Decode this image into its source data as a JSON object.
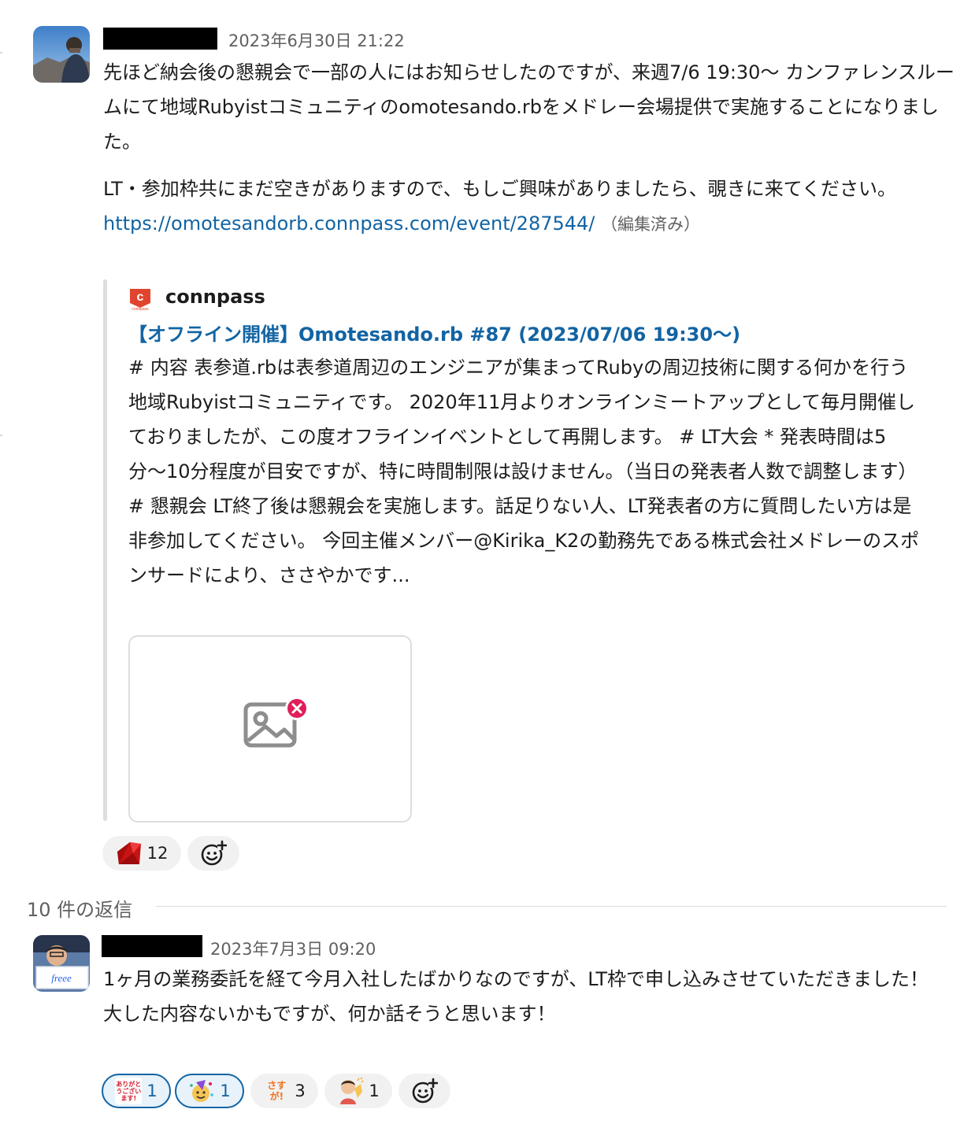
{
  "message": {
    "timestamp": "2023年6月30日 21:22",
    "paragraph1": "先ほど納会後の懇親会で一部の人にはお知らせしたのですが、来週7/6 19:30〜 カンファレンスルームにて地域Rubyistコミュニティのomotesando.rbをメドレー会場提供で実施することになりました。",
    "paragraph2": "LT・参加枠共にまだ空きがありますので、もしご興味がありましたら、覗きに来てください。",
    "link": "https://omotesandorb.connpass.com/event/287544/",
    "edited_label": "（編集済み）",
    "unfurl": {
      "site_name": "connpass",
      "logo_letter": "c",
      "logo_sub": "connpass",
      "title": "【オフライン開催】Omotesando.rb #87 (2023/07/06 19:30〜)",
      "description": "# 内容 表参道.rbは表参道周辺のエンジニアが集まってRubyの周辺技術に関する何かを行う地域Rubyistコミュニティです。 2020年11月よりオンラインミートアップとして毎月開催しておりましたが、この度オフラインイベントとして再開します。 # LT大会 * 発表時間は5分〜10分程度が目安ですが、特に時間制限は設けません。（当日の発表者人数で調整します） # 懇親会 LT終了後は懇親会を実施します。話足りない人、LT発表者の方に質問したい方は是非参加してください。 今回主催メンバー@Kirika_K2の勤務先である株式会社メドレーのスポンサードにより、ささやかです..."
    },
    "reactions": [
      {
        "icon": "ruby-gem-icon",
        "count": "12",
        "active": false
      }
    ]
  },
  "replies_label": "10 件の返信",
  "reply": {
    "timestamp": "2023年7月3日 09:20",
    "line1": "1ヶ月の業務委託を経て今月入社したばかりなのですが、LT枠で申し込みさせていただきました！",
    "line2": "大した内容ないかもですが、何か話そうと思います！",
    "avatar_sign_text": "freee",
    "reactions": [
      {
        "icon": "arigatou-gozaimasu-icon",
        "emoji_text": "ありがとうございます!",
        "count": "1",
        "active": true
      },
      {
        "icon": "party-person-icon",
        "count": "1",
        "active": true
      },
      {
        "icon": "sasuga-icon",
        "emoji_text": "さすが!",
        "count": "3",
        "active": false
      },
      {
        "icon": "clapping-person-icon",
        "count": "1",
        "active": false
      }
    ]
  },
  "colors": {
    "link": "#1264a3",
    "text": "#1d1c1d",
    "muted": "#616061",
    "connpass_red": "#e0442e",
    "broken_image_badge": "#e01e5a"
  }
}
